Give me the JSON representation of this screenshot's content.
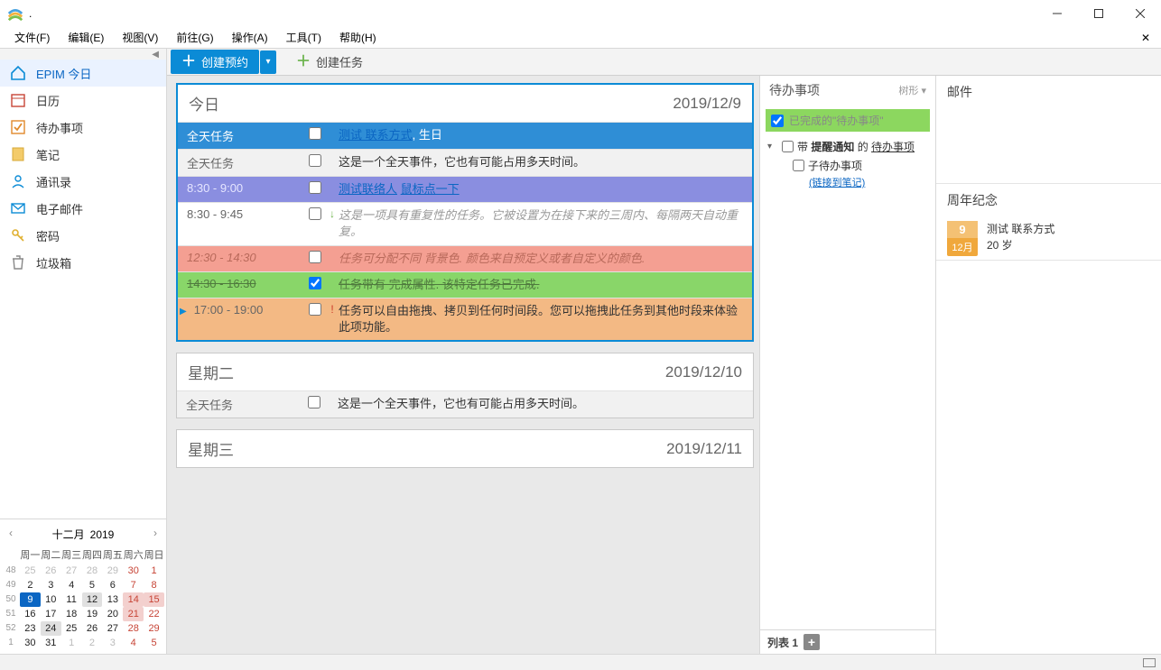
{
  "window": {
    "title": "."
  },
  "menus": [
    "文件(F)",
    "编辑(E)",
    "视图(V)",
    "前往(G)",
    "操作(A)",
    "工具(T)",
    "帮助(H)"
  ],
  "nav": [
    {
      "label": "EPIM 今日",
      "icon": "home",
      "active": true
    },
    {
      "label": "日历",
      "icon": "calendar"
    },
    {
      "label": "待办事项",
      "icon": "todo"
    },
    {
      "label": "笔记",
      "icon": "notes"
    },
    {
      "label": "通讯录",
      "icon": "contacts"
    },
    {
      "label": "电子邮件",
      "icon": "mail"
    },
    {
      "label": "密码",
      "icon": "password"
    },
    {
      "label": "垃圾箱",
      "icon": "trash"
    }
  ],
  "toolbar": {
    "new_appt": "创建预约",
    "new_task": "创建任务"
  },
  "agenda": {
    "days": [
      {
        "title": "今日",
        "date": "2019/12/9",
        "today": true,
        "entries": [
          {
            "time": "全天任务",
            "bg": "blue",
            "checked": false,
            "text_parts": [
              {
                "t": "测试 联系方式",
                "link": true
              },
              {
                "t": ", 生日"
              }
            ]
          },
          {
            "time": "全天任务",
            "bg": "grey",
            "checked": false,
            "text": "这是一个全天事件，它也有可能占用多天时间。"
          },
          {
            "time": "8:30 - 9:00",
            "bg": "purple",
            "checked": false,
            "text_parts": [
              {
                "t": "测试联络人",
                "link": true
              },
              {
                "t": "  "
              },
              {
                "t": "鼠标点一下",
                "link": true
              }
            ]
          },
          {
            "time": "8:30 - 9:45",
            "bg": "none",
            "checked": false,
            "mark": "↓",
            "mark_color": "#6ab34b",
            "text": "这是一项具有重复性的任务。它被设置为在接下来的三周内、每隔两天自动重复。",
            "italic": true,
            "grey": true
          },
          {
            "time": "12:30 - 14:30",
            "bg": "salmon",
            "checked": false,
            "text": "任务可分配不同 背景色. 颜色来自预定义或者自定义的颜色."
          },
          {
            "time": "14:30 - 16:30",
            "bg": "green",
            "checked": true,
            "text": "任务带有 完成属性. 该特定任务已完成."
          },
          {
            "time": "17:00 - 19:00",
            "bg": "orange",
            "checked": false,
            "mark": "!",
            "mark_color": "#cc3a2a",
            "current": true,
            "text": "任务可以自由拖拽、拷贝到任何时间段。您可以拖拽此任务到其他时段来体验此项功能。"
          }
        ]
      },
      {
        "title": "星期二",
        "date": "2019/12/10",
        "entries": [
          {
            "time": "全天任务",
            "bg": "grey",
            "checked": false,
            "text": "这是一个全天事件，它也有可能占用多天时间。"
          }
        ]
      },
      {
        "title": "星期三",
        "date": "2019/12/11",
        "entries": []
      }
    ]
  },
  "todos": {
    "title": "待办事项",
    "mode": "树形",
    "completed_label": "已完成的\"待办事项\"",
    "root": {
      "label_pre": "带 ",
      "label_strong": "提醒通知",
      "label_mid": " 的 ",
      "label_end": "待办事项"
    },
    "child": {
      "label": "子待办事项",
      "link": "(链接到笔记)"
    },
    "list_tab": "列表 1"
  },
  "mail_title": "邮件",
  "anniv": {
    "title": "周年纪念",
    "day": "9",
    "month": "12月",
    "name": "测试 联系方式",
    "age": "20 岁"
  },
  "mini_cal": {
    "month": "十二月",
    "year": "2019",
    "dow": [
      "周一",
      "周二",
      "周三",
      "周四",
      "周五",
      "周六",
      "周日"
    ],
    "weeks": [
      {
        "wk": "48",
        "days": [
          {
            "n": 25,
            "o": 1
          },
          {
            "n": 26,
            "o": 1
          },
          {
            "n": 27,
            "o": 1
          },
          {
            "n": 28,
            "o": 1
          },
          {
            "n": 29,
            "o": 1
          },
          {
            "n": 30,
            "o": 1,
            "sat": 1
          },
          {
            "n": 1,
            "sun": 1
          }
        ]
      },
      {
        "wk": "49",
        "days": [
          {
            "n": 2
          },
          {
            "n": 3
          },
          {
            "n": 4
          },
          {
            "n": 5
          },
          {
            "n": 6
          },
          {
            "n": 7,
            "sat": 1
          },
          {
            "n": 8,
            "sun": 1
          }
        ]
      },
      {
        "wk": "50",
        "days": [
          {
            "n": 9,
            "sel": 1
          },
          {
            "n": 10
          },
          {
            "n": 11
          },
          {
            "n": 12,
            "hl": 1
          },
          {
            "n": 13
          },
          {
            "n": 14,
            "sat": 1,
            "redhl": 1
          },
          {
            "n": 15,
            "sun": 1,
            "redhl": 1
          }
        ]
      },
      {
        "wk": "51",
        "days": [
          {
            "n": 16
          },
          {
            "n": 17
          },
          {
            "n": 18
          },
          {
            "n": 19
          },
          {
            "n": 20
          },
          {
            "n": 21,
            "sat": 1,
            "redhl": 1
          },
          {
            "n": 22,
            "sun": 1
          }
        ]
      },
      {
        "wk": "52",
        "days": [
          {
            "n": 23
          },
          {
            "n": 24,
            "hl": 1
          },
          {
            "n": 25
          },
          {
            "n": 26
          },
          {
            "n": 27
          },
          {
            "n": 28,
            "sat": 1
          },
          {
            "n": 29,
            "sun": 1
          }
        ]
      },
      {
        "wk": "1",
        "days": [
          {
            "n": 30
          },
          {
            "n": 31
          },
          {
            "n": 1,
            "o": 1
          },
          {
            "n": 2,
            "o": 1
          },
          {
            "n": 3,
            "o": 1
          },
          {
            "n": 4,
            "o": 1,
            "sat": 1
          },
          {
            "n": 5,
            "o": 1,
            "sun": 1
          }
        ]
      }
    ]
  }
}
